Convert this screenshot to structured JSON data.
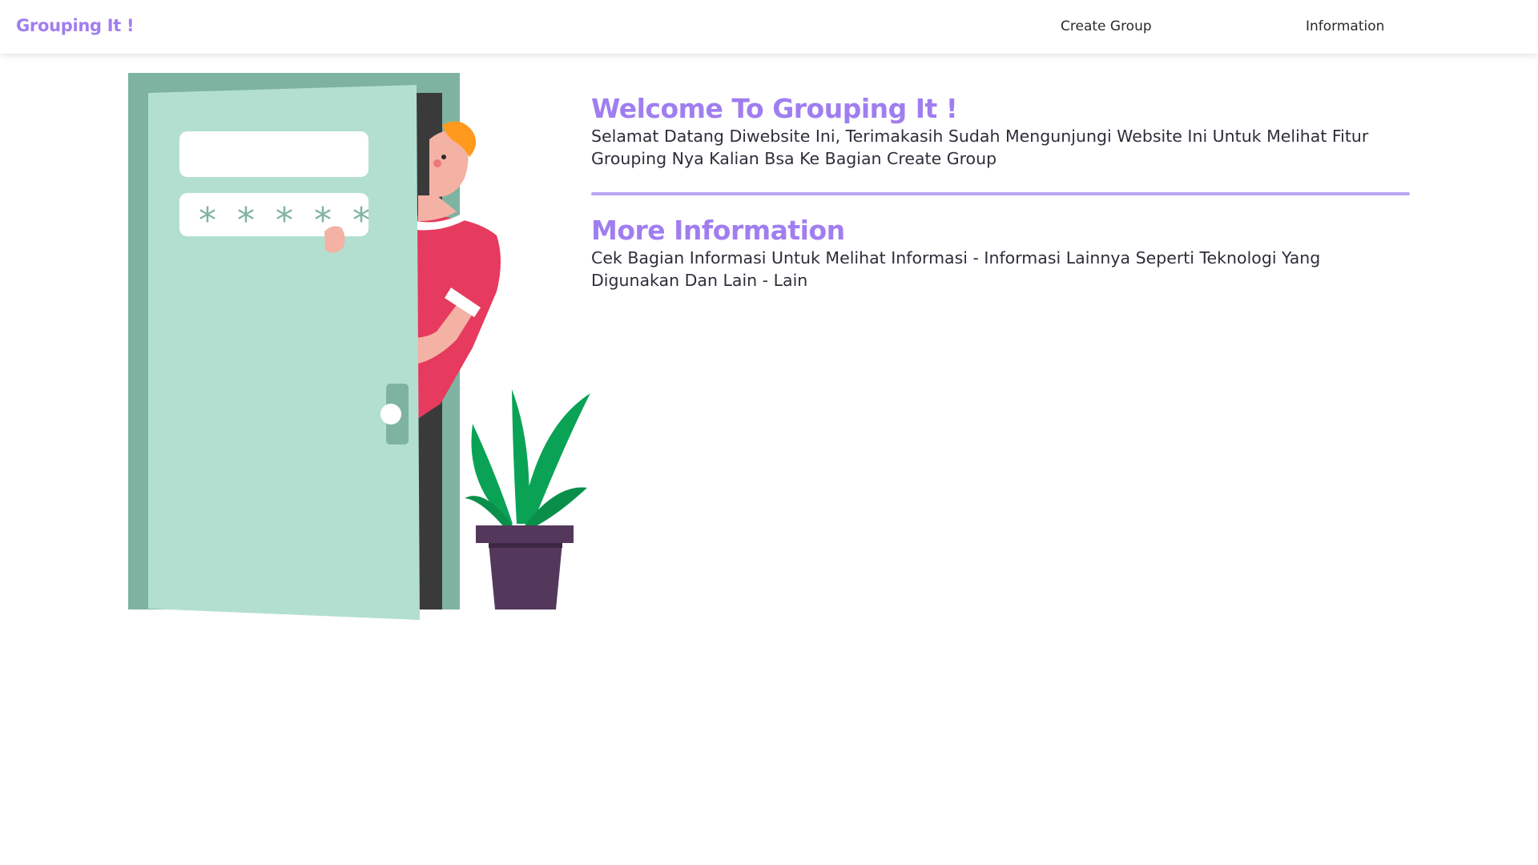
{
  "navbar": {
    "brand": "Grouping It !",
    "links": [
      {
        "label": "Create Group"
      },
      {
        "label": "Information"
      }
    ]
  },
  "welcome": {
    "title": "Welcome To Grouping It !",
    "text": "Selamat Datang Diwebsite Ini, Terimakasih Sudah Mengunjungi Website Ini Untuk Melihat Fitur Grouping Nya Kalian Bsa Ke Bagian Create Group"
  },
  "more_info": {
    "title": "More Information",
    "text": "Cek Bagian Informasi Untuk Melihat Informasi - Informasi Lainnya Seperti Teknologi Yang Digunakan Dan Lain - Lain"
  },
  "illustration": {
    "password_mask": "* * * * *"
  },
  "colors": {
    "accent": "#a07ef0",
    "divider": "#b7a6f3",
    "door": "#b3dfd1",
    "door_frame": "#7fb3a1",
    "shirt": "#e63a5e",
    "plant_pot": "#54385c",
    "leaves": "#0aa356"
  }
}
